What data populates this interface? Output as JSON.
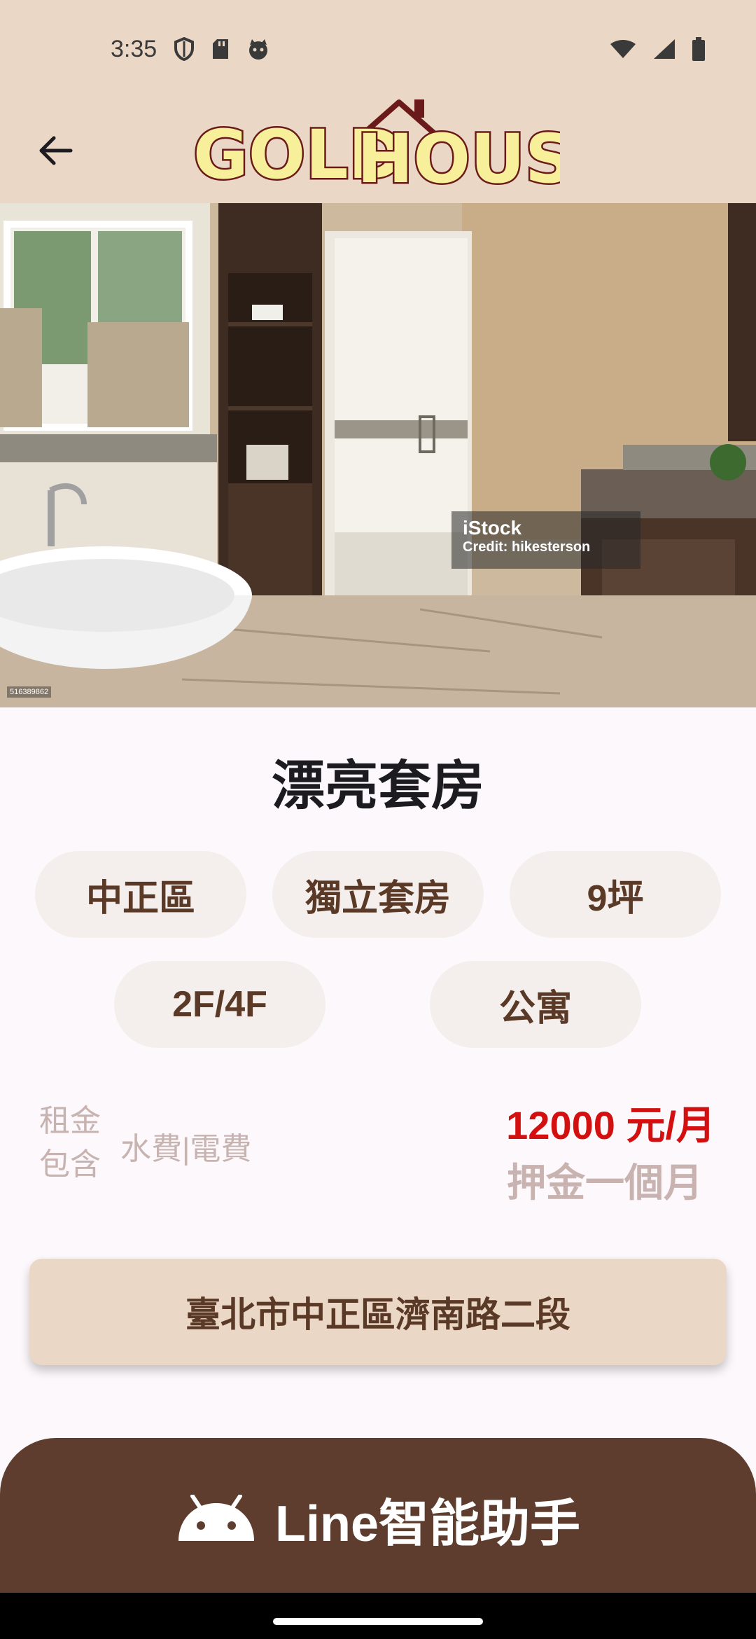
{
  "status_bar": {
    "time": "3:35",
    "icons": [
      "shield-icon",
      "sd-card-icon",
      "cat-face-icon",
      "wifi-icon",
      "signal-icon",
      "battery-icon"
    ]
  },
  "app_bar": {
    "back_icon": "arrow-left-icon",
    "logo_text_1": "GOLD",
    "logo_text_2": "HOUSE"
  },
  "hero": {
    "watermark_brand": "iStock",
    "watermark_credit": "Credit: hikesterson",
    "image_id": "516389862"
  },
  "listing": {
    "title": "漂亮套房",
    "tags": [
      "中正區",
      "獨立套房",
      "9坪",
      "2F/4F",
      "公寓"
    ],
    "included_label": "租金包含",
    "included_value": "水費|電費",
    "price": "12000 元/月",
    "deposit": "押金一個月",
    "address": "臺北市中正區濟南路二段"
  },
  "bottom_action": {
    "icon": "android-icon",
    "label": "Line智能助手"
  },
  "colors": {
    "header_bg": "#ead7c6",
    "brown": "#5e3d2e",
    "price_red": "#d40f0f",
    "chip_bg": "#f4efec"
  }
}
